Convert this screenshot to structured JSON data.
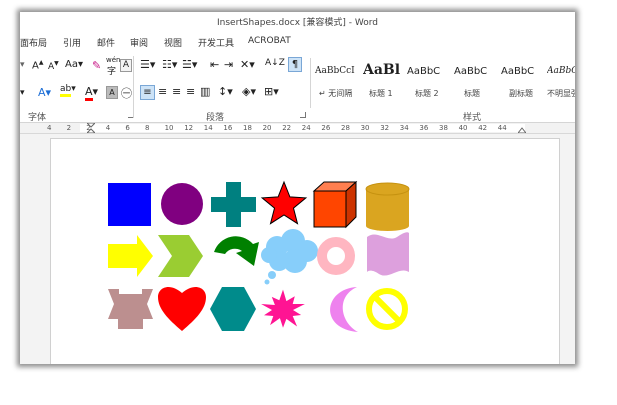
{
  "window": {
    "title": "InsertShapes.docx [兼容模式] - Word"
  },
  "menu": {
    "items": [
      "面布局",
      "引用",
      "邮件",
      "审阅",
      "视图",
      "开发工具",
      "ACROBAT"
    ]
  },
  "ribbon": {
    "font_group_label": "字体",
    "paragraph_group_label": "段落",
    "styles_group_label": "样式",
    "font_grow": "A",
    "font_shrink": "A",
    "change_case": "Aa",
    "highlight_letters": "ab",
    "text_effects": "A",
    "font_color": "A",
    "char_shading": "A",
    "enclose_char": "字",
    "phonetic": "wén",
    "char_border": "A",
    "sort": "A↓Z",
    "styles": [
      {
        "preview": "AaBbCcI",
        "name": "↵ 无间隔"
      },
      {
        "preview": "AaBl",
        "name": "标题 1"
      },
      {
        "preview": "AaBbC",
        "name": "标题 2"
      },
      {
        "preview": "AaBbC",
        "name": "标题"
      },
      {
        "preview": "AaBbC",
        "name": "副标题"
      },
      {
        "preview": "AaBbCc",
        "name": "不明显强"
      }
    ]
  },
  "ruler": {
    "numbers": [
      "4",
      "2",
      "2",
      "4",
      "6",
      "8",
      "10",
      "12",
      "14",
      "16",
      "18",
      "20",
      "22",
      "24",
      "26",
      "28",
      "30",
      "32",
      "34",
      "36",
      "38",
      "40",
      "42",
      "44"
    ]
  },
  "colors": {
    "square": "#0000ff",
    "circle": "#800080",
    "plus": "#008080",
    "star": "#ff0000",
    "cube_front": "#ff4500",
    "cube_top": "#ff7f50",
    "cube_side": "#cc3300",
    "can": "#daa520",
    "arrow": "#ffff00",
    "chevron": "#9acd32",
    "curved_arrow": "#008000",
    "cloud": "#87cefa",
    "donut": "#ffb6c1",
    "wave": "#dda0dd",
    "ribbon_shape": "#bc8f8f",
    "heart": "#ff0000",
    "hexagon": "#008b8b",
    "explosion": "#ff1493",
    "moon": "#ee82ee",
    "no_symbol": "#ffff00",
    "shape_outline": "#000000"
  },
  "shapes": [
    "square",
    "circle",
    "plus",
    "star",
    "cube",
    "can",
    "arrow",
    "chevron",
    "curved-arrow",
    "cloud-callout",
    "donut",
    "wave",
    "ribbon",
    "heart",
    "hexagon",
    "explosion",
    "moon",
    "no-symbol"
  ]
}
